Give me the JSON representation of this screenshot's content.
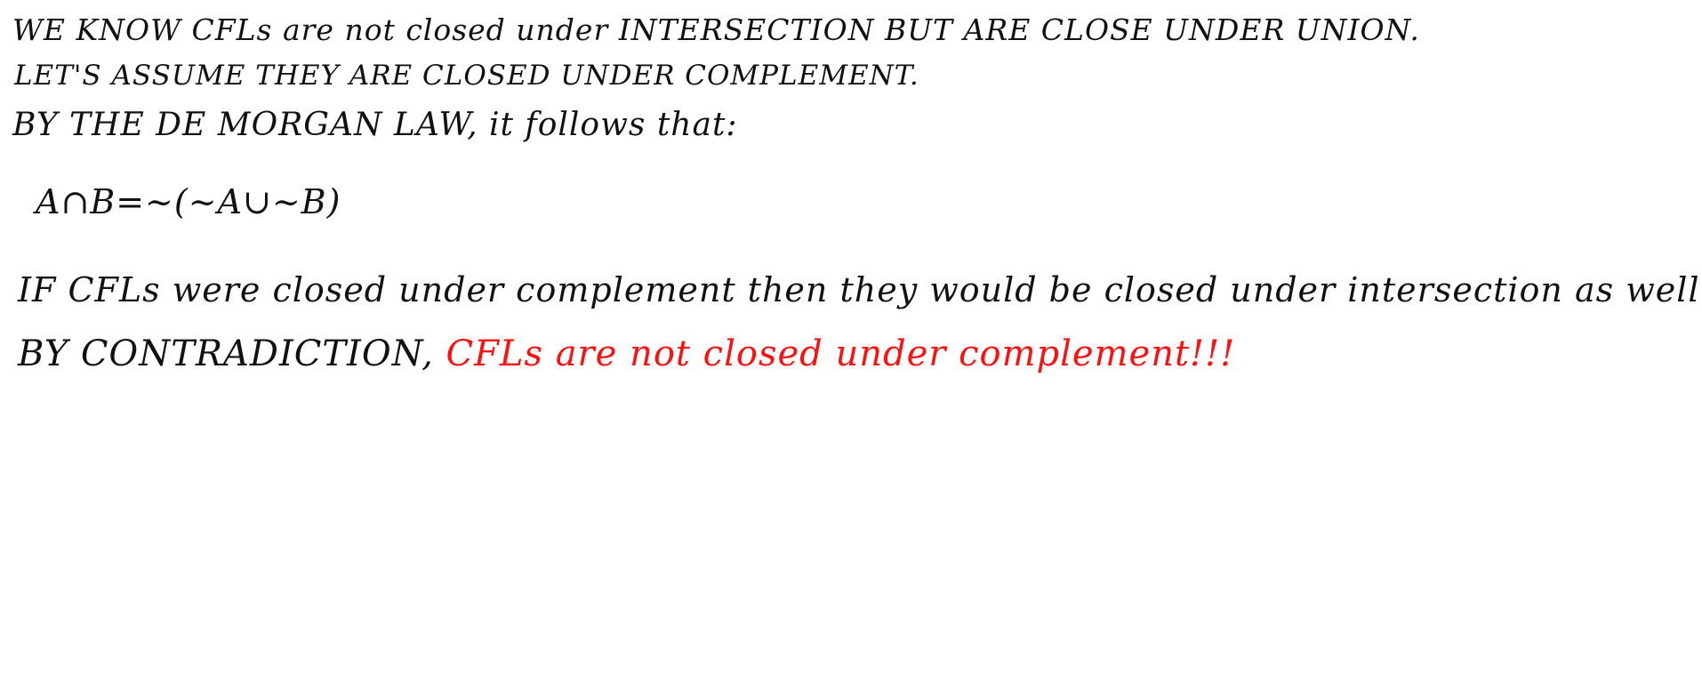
{
  "note": {
    "lines": [
      "WE KNOW CFLs are not closed under INTERSECTION BUT ARE CLOSE UNDER UNION.",
      "LET'S ASSUME THEY ARE CLOSED UNDER COMPLEMENT.",
      "BY THE DE MORGAN LAW, it follows that:",
      "A∩B=~(~A∪~B)",
      "IF CFLs were closed under complement then they would be closed under intersection as well !!",
      "BY CONTRADICTION,"
    ],
    "conclusion": "CFLs are not closed under complement!!!",
    "colors": {
      "ink": "#111111",
      "highlight": "#ff1010",
      "background": "#ffffff"
    }
  }
}
